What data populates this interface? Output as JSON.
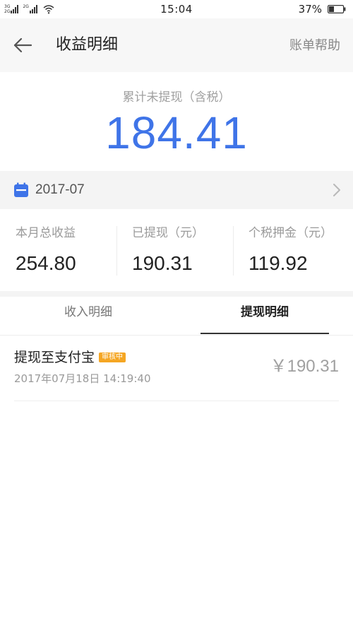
{
  "status_bar": {
    "network_1": "3G",
    "network_1b": "2G",
    "network_2": "2G",
    "time": "15:04",
    "battery_percent": "37%",
    "battery_level": 0.37
  },
  "header": {
    "title": "收益明细",
    "help_label": "账单帮助"
  },
  "summary": {
    "label": "累计未提现（含税）",
    "amount": "184.41"
  },
  "month": {
    "value": "2017-07"
  },
  "stats": [
    {
      "label": "本月总收益",
      "value": "254.80"
    },
    {
      "label": "已提现（元）",
      "value": "190.31"
    },
    {
      "label": "个税押金（元）",
      "value": "119.92"
    }
  ],
  "tabs": [
    {
      "label": "收入明细",
      "active": false
    },
    {
      "label": "提现明细",
      "active": true
    }
  ],
  "records": [
    {
      "title": "提现至支付宝",
      "status": "审核中",
      "time": "2017年07月18日 14:19:40",
      "amount": "￥190.31"
    }
  ],
  "colors": {
    "accent": "#3f74e8",
    "badge": "#f5a623"
  },
  "icons": {
    "back": "arrow-left-icon",
    "calendar": "calendar-icon",
    "chevron": "chevron-right-icon",
    "wifi": "wifi-icon",
    "battery": "battery-icon"
  }
}
